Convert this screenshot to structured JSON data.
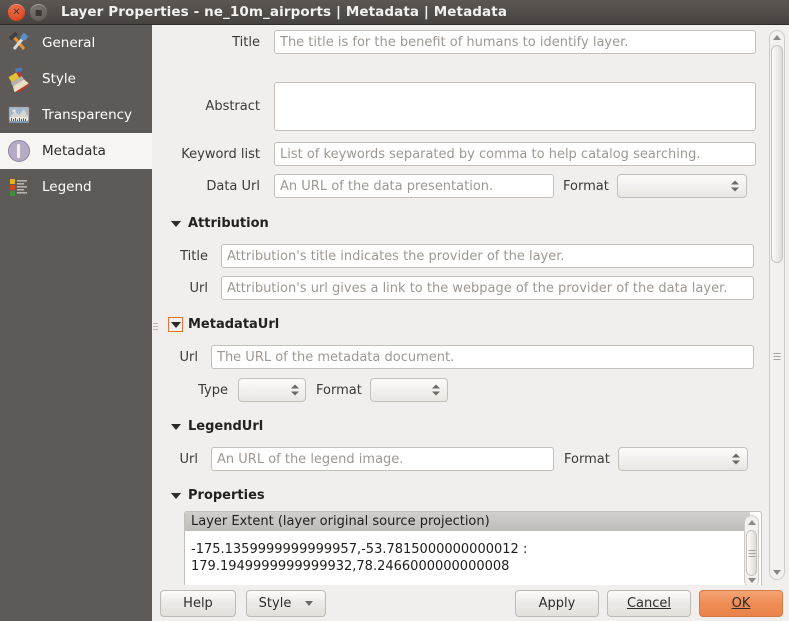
{
  "window": {
    "title": "Layer Properties - ne_10m_airports | Metadata | Metadata",
    "close_icon": "close-icon",
    "maximize_icon": "maximize-icon",
    "close_glyph": "✕",
    "maximize_glyph": "■"
  },
  "sidebar": {
    "items": [
      {
        "label": "General",
        "icon": "hammer-wrench-icon",
        "selected": false
      },
      {
        "label": "Style",
        "icon": "paintbrush-icon",
        "selected": false
      },
      {
        "label": "Transparency",
        "icon": "image-histogram-icon",
        "selected": false
      },
      {
        "label": "Metadata",
        "icon": "info-circle-icon",
        "selected": true
      },
      {
        "label": "Legend",
        "icon": "legend-list-icon",
        "selected": false
      }
    ]
  },
  "form": {
    "title": {
      "label": "Title",
      "value": "",
      "placeholder": "The title is for the benefit of humans to identify layer."
    },
    "abstract": {
      "label": "Abstract",
      "value": "",
      "placeholder": ""
    },
    "keyword_list": {
      "label": "Keyword list",
      "value": "",
      "placeholder": "List of keywords separated by comma to help catalog searching."
    },
    "data_url": {
      "label": "Data Url",
      "value": "",
      "placeholder": "An URL of the data presentation."
    },
    "data_url_format": {
      "label": "Format",
      "value": ""
    },
    "attribution": {
      "group_label": "Attribution",
      "expanded": true,
      "title": {
        "label": "Title",
        "value": "",
        "placeholder": "Attribution's title indicates the provider of the layer."
      },
      "url": {
        "label": "Url",
        "value": "",
        "placeholder": "Attribution's url gives a link to the webpage of the provider of the data layer."
      }
    },
    "metadata_url": {
      "group_label": "MetadataUrl",
      "expanded": true,
      "focused": true,
      "url": {
        "label": "Url",
        "value": "",
        "placeholder": "The URL of the metadata document."
      },
      "type": {
        "label": "Type",
        "value": ""
      },
      "format": {
        "label": "Format",
        "value": ""
      }
    },
    "legend_url": {
      "group_label": "LegendUrl",
      "expanded": true,
      "url": {
        "label": "Url",
        "value": "",
        "placeholder": "An URL of the legend image."
      },
      "format": {
        "label": "Format",
        "value": ""
      }
    },
    "properties": {
      "group_label": "Properties",
      "expanded": true,
      "extent_header": "Layer Extent (layer original source projection)",
      "extent_line1": "-175.1359999999999957,-53.7815000000000012 :",
      "extent_line2": "179.1949999999999932,78.2466000000000008"
    }
  },
  "buttons": {
    "help": "Help",
    "style": "Style",
    "apply": "Apply",
    "cancel": "Cancel",
    "ok": "OK"
  },
  "colors": {
    "titlebar": "#4c4845",
    "sidebar": "#5d5a57",
    "accent_ok": "#ef8c55",
    "focus_outline": "#e8703a",
    "dialog_bg": "#f0efee"
  }
}
